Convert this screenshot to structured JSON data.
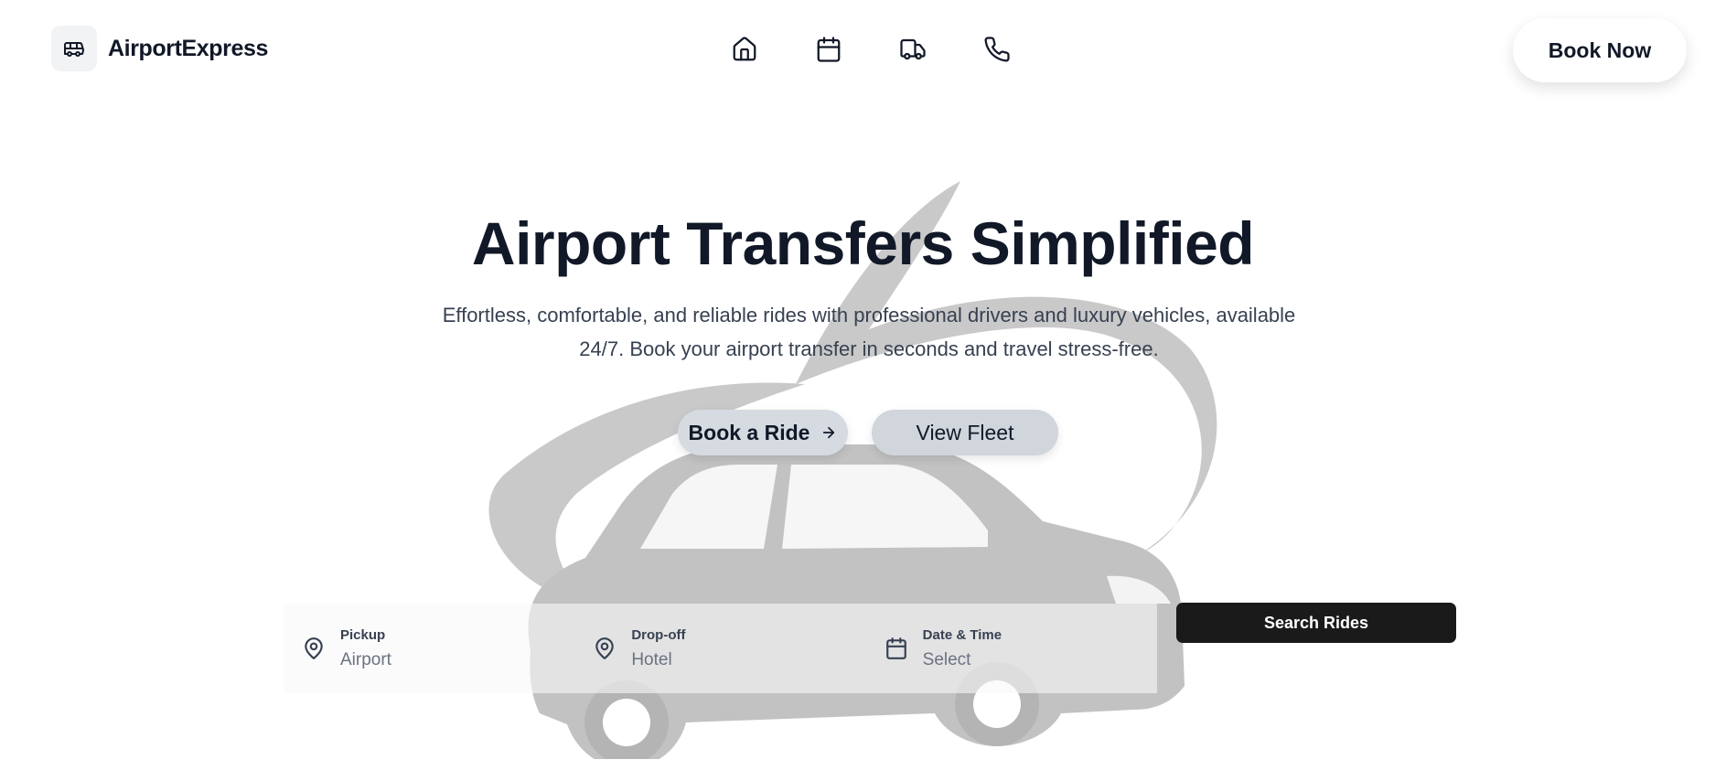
{
  "brand": {
    "name": "AirportExpress",
    "icon": "bus-icon"
  },
  "nav": [
    {
      "icon": "home-icon"
    },
    {
      "icon": "calendar-icon"
    },
    {
      "icon": "truck-icon"
    },
    {
      "icon": "phone-icon"
    }
  ],
  "header": {
    "book_now_label": "Book Now"
  },
  "hero": {
    "title": "Airport Transfers Simplified",
    "subtitle": "Effortless, comfortable, and reliable rides with professional drivers and luxury vehicles, available 24/7. Book your airport transfer in seconds and travel stress-free.",
    "primary_cta": "Book a Ride",
    "primary_cta_icon": "arrow-right-icon",
    "secondary_cta": "View Fleet"
  },
  "search": {
    "pickup": {
      "label": "Pickup",
      "value": "Airport",
      "icon": "map-pin-icon"
    },
    "dropoff": {
      "label": "Drop-off",
      "value": "Hotel",
      "icon": "map-pin-icon"
    },
    "datetime": {
      "label": "Date & Time",
      "value": "Select",
      "icon": "calendar-icon"
    },
    "button_label": "Search Rides"
  },
  "colors": {
    "text": "#111827",
    "muted": "#6b7280",
    "button_dark": "#1a1a1a",
    "pill": "#d6dae1"
  }
}
